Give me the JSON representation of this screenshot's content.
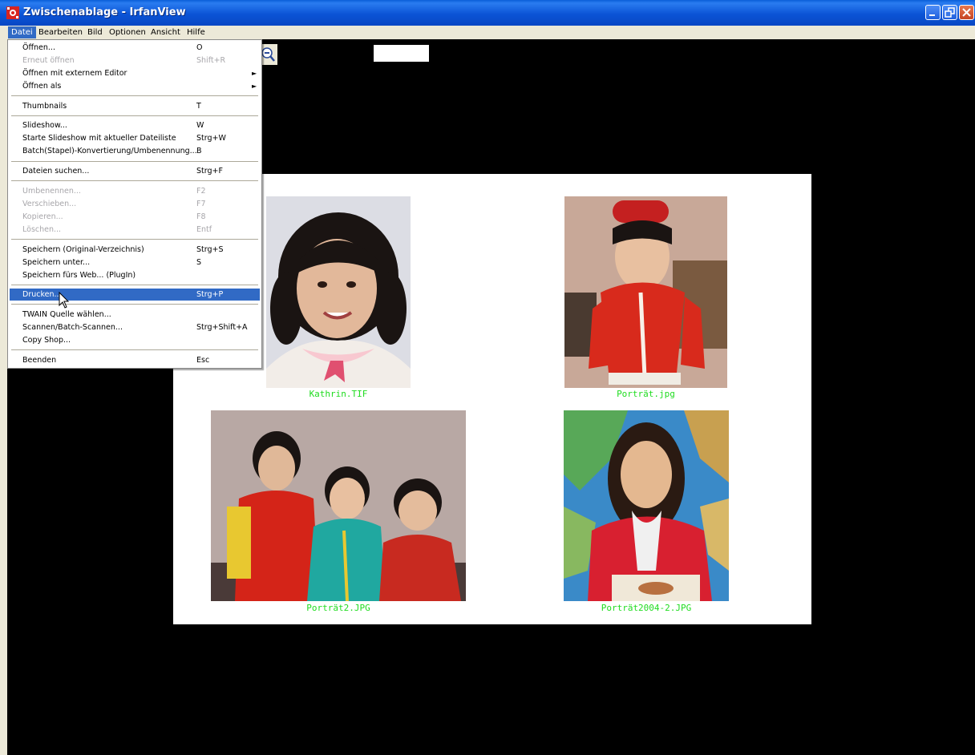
{
  "window": {
    "title": "Zwischenablage - IrfanView"
  },
  "menubar": {
    "items": [
      "Datei",
      "Bearbeiten",
      "Bild",
      "Optionen",
      "Ansicht",
      "Hilfe"
    ],
    "active": "Datei"
  },
  "file_menu": {
    "items": [
      {
        "label": "Öffnen...",
        "shortcut": "O",
        "enabled": true
      },
      {
        "label": "Erneut öffnen",
        "shortcut": "Shift+R",
        "enabled": false
      },
      {
        "label": "Öffnen mit externem Editor",
        "shortcut": "",
        "enabled": true,
        "submenu": true
      },
      {
        "label": "Öffnen als",
        "shortcut": "",
        "enabled": true,
        "submenu": true
      },
      {
        "label": "Thumbnails",
        "shortcut": "T",
        "enabled": true
      },
      {
        "label": "Slideshow...",
        "shortcut": "W",
        "enabled": true
      },
      {
        "label": "Starte Slideshow mit aktueller Dateiliste",
        "shortcut": "Strg+W",
        "enabled": true
      },
      {
        "label": "Batch(Stapel)-Konvertierung/Umbenennung...",
        "shortcut": "B",
        "enabled": true
      },
      {
        "label": "Dateien suchen...",
        "shortcut": "Strg+F",
        "enabled": true
      },
      {
        "label": "Umbenennen...",
        "shortcut": "F2",
        "enabled": false
      },
      {
        "label": "Verschieben...",
        "shortcut": "F7",
        "enabled": false
      },
      {
        "label": "Kopieren...",
        "shortcut": "F8",
        "enabled": false
      },
      {
        "label": "Löschen...",
        "shortcut": "Entf",
        "enabled": false
      },
      {
        "label": "Speichern (Original-Verzeichnis)",
        "shortcut": "Strg+S",
        "enabled": true
      },
      {
        "label": "Speichern unter...",
        "shortcut": "S",
        "enabled": true
      },
      {
        "label": "Speichern fürs Web... (PlugIn)",
        "shortcut": "",
        "enabled": true
      },
      {
        "label": "Drucken...",
        "shortcut": "Strg+P",
        "enabled": true,
        "highlighted": true
      },
      {
        "label": "TWAIN Quelle wählen...",
        "shortcut": "",
        "enabled": true
      },
      {
        "label": "Scannen/Batch-Scannen...",
        "shortcut": "Strg+Shift+A",
        "enabled": true
      },
      {
        "label": "Copy Shop...",
        "shortcut": "",
        "enabled": true
      },
      {
        "label": "Beenden",
        "shortcut": "Esc",
        "enabled": true
      }
    ]
  },
  "thumbnails": [
    {
      "caption": "Kathrin.TIF"
    },
    {
      "caption": "Porträt.jpg"
    },
    {
      "caption": "Porträt2.JPG"
    },
    {
      "caption": "Porträt2004-2.JPG"
    }
  ],
  "colors": {
    "titlebar": "#0b54d6",
    "menu_highlight": "#316ac5",
    "caption": "#1fdc1f",
    "background": "#000000"
  }
}
